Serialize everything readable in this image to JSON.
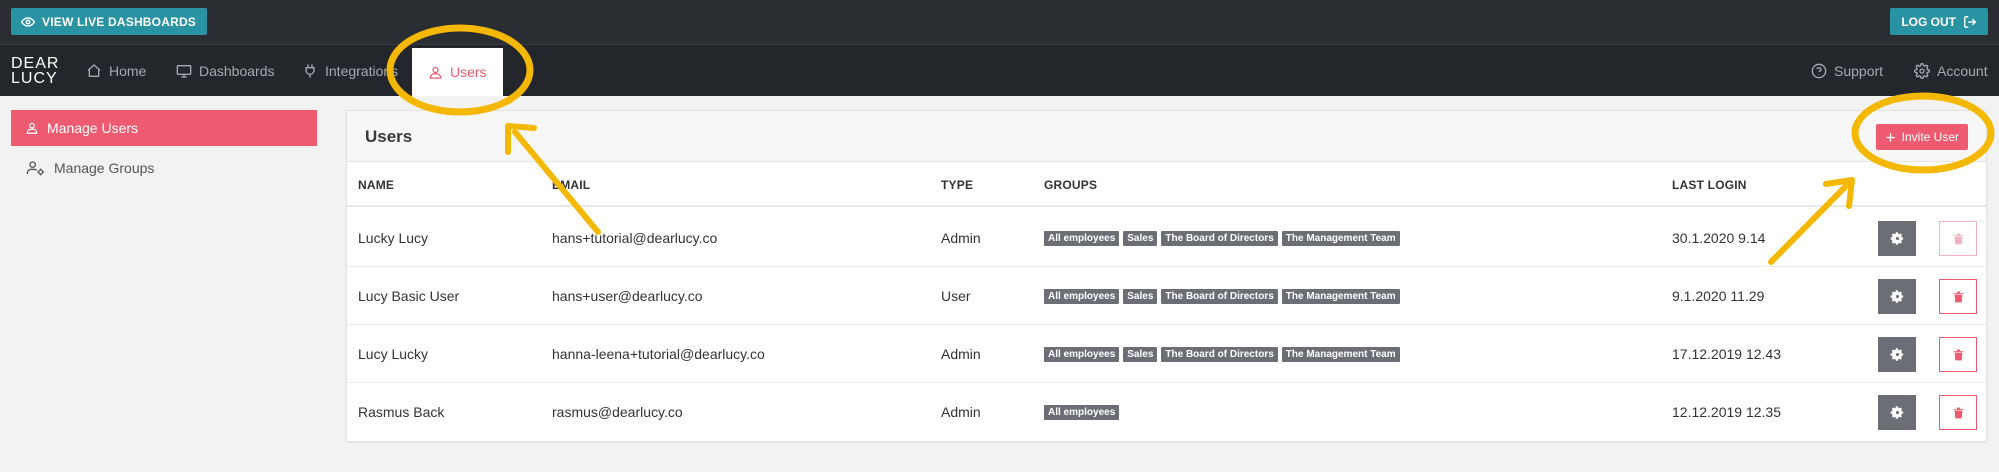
{
  "topbar": {
    "view_live_label": "VIEW LIVE DASHBOARDS",
    "logout_label": "LOG OUT"
  },
  "nav": {
    "logo_line1": "DEAR",
    "logo_line2": "LUCY",
    "items": [
      {
        "label": "Home",
        "icon": "home-icon"
      },
      {
        "label": "Dashboards",
        "icon": "monitor-icon"
      },
      {
        "label": "Integrations",
        "icon": "plug-icon"
      },
      {
        "label": "Users",
        "icon": "user-icon",
        "active": true
      }
    ],
    "right_items": [
      {
        "label": "Support",
        "icon": "help-circle-icon"
      },
      {
        "label": "Account",
        "icon": "gear-icon"
      }
    ]
  },
  "sidebar": {
    "items": [
      {
        "label": "Manage Users",
        "icon": "user-icon",
        "active": true
      },
      {
        "label": "Manage Groups",
        "icon": "users-gear-icon"
      }
    ]
  },
  "panel": {
    "title": "Users",
    "invite_label": "Invite User"
  },
  "table": {
    "columns": [
      "NAME",
      "EMAIL",
      "TYPE",
      "GROUPS",
      "LAST LOGIN"
    ],
    "rows": [
      {
        "name": "Lucky Lucy",
        "email": "hans+tutorial@dearlucy.co",
        "type": "Admin",
        "groups": [
          "All employees",
          "Sales",
          "The Board of Directors",
          "The Management Team"
        ],
        "last_login": "30.1.2020 9.14"
      },
      {
        "name": "Lucy Basic User",
        "email": "hans+user@dearlucy.co",
        "type": "User",
        "groups": [
          "All employees",
          "Sales",
          "The Board of Directors",
          "The Management Team"
        ],
        "last_login": "9.1.2020 11.29"
      },
      {
        "name": "Lucy Lucky",
        "email": "hanna-leena+tutorial@dearlucy.co",
        "type": "Admin",
        "groups": [
          "All employees",
          "Sales",
          "The Board of Directors",
          "The Management Team"
        ],
        "last_login": "17.12.2019 12.43"
      },
      {
        "name": "Rasmus Back",
        "email": "rasmus@dearlucy.co",
        "type": "Admin",
        "groups": [
          "All employees"
        ],
        "last_login": "12.12.2019 12.35"
      }
    ]
  },
  "colors": {
    "accent": "#ee5a6f",
    "teal": "#2a93a3",
    "dark": "#23262a",
    "highlight": "#f5b800"
  }
}
